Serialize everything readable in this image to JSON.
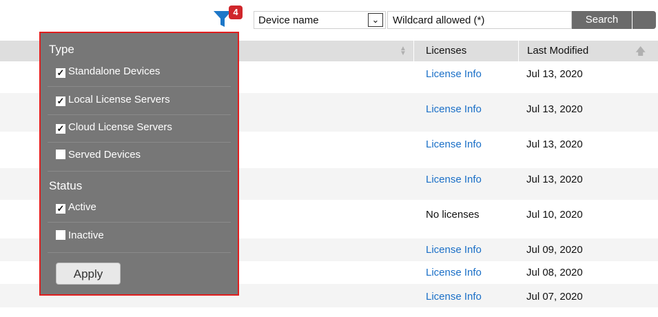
{
  "toolbar": {
    "filter_badge": "4",
    "field_select": "Device name",
    "search_placeholder": "Wildcard allowed (*)",
    "search_label": "Search"
  },
  "table": {
    "headers": [
      "Licenses",
      "Last Modified"
    ],
    "rows": [
      {
        "license": "License Info",
        "modified": "Jul 13, 2020"
      },
      {
        "license": "License Info",
        "modified": "Jul 13, 2020"
      },
      {
        "license": "License Info",
        "modified": "Jul 13, 2020"
      },
      {
        "license": "License Info",
        "modified": "Jul 13, 2020"
      },
      {
        "license": "No licenses",
        "modified": "Jul 10, 2020"
      },
      {
        "license": "License Info",
        "modified": "Jul 09, 2020"
      },
      {
        "license": "License Info",
        "modified": "Jul 08, 2020"
      },
      {
        "license": "License Info",
        "modified": "Jul 07, 2020"
      }
    ]
  },
  "filter_panel": {
    "type_title": "Type",
    "type_options": [
      {
        "label": "Standalone Devices",
        "checked": true
      },
      {
        "label": "Local License Servers",
        "checked": true
      },
      {
        "label": "Cloud License Servers",
        "checked": true
      },
      {
        "label": "Served Devices",
        "checked": false
      }
    ],
    "status_title": "Status",
    "status_options": [
      {
        "label": "Active",
        "checked": true
      },
      {
        "label": "Inactive",
        "checked": false
      }
    ],
    "apply_label": "Apply"
  },
  "colors": {
    "accent": "#1a6fc7",
    "panel": "#777777",
    "highlight": "#e11d1d",
    "badge": "#d0262b"
  }
}
